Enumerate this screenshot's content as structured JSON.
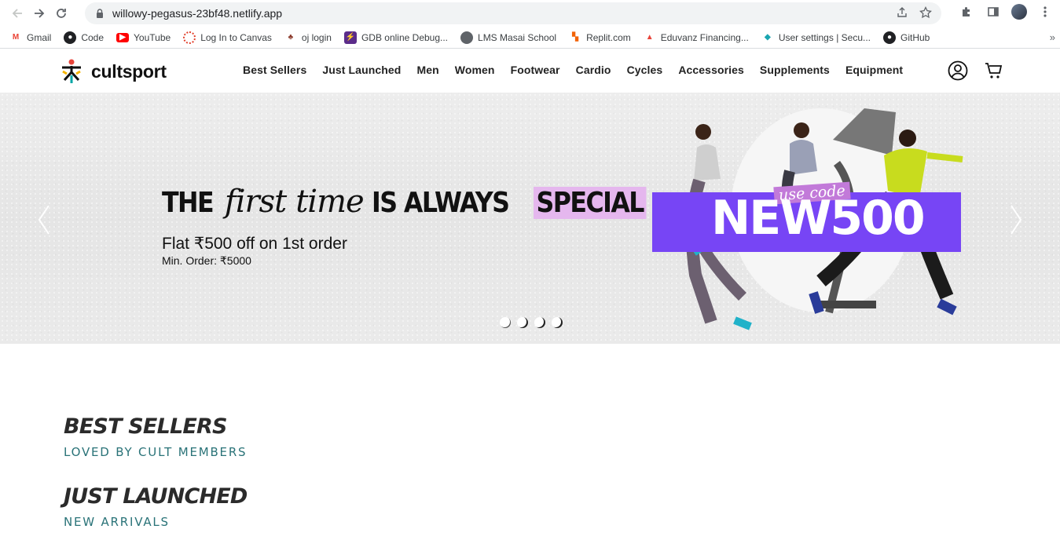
{
  "browser": {
    "url": "willowy-pegasus-23bf48.netlify.app",
    "bookmarks": [
      {
        "label": "Gmail",
        "icon": "gmail-icon",
        "color": "#ea4335"
      },
      {
        "label": "Code",
        "icon": "github-icon",
        "color": "#202124"
      },
      {
        "label": "YouTube",
        "icon": "youtube-icon",
        "color": "#ff0000"
      },
      {
        "label": "Log In to Canvas",
        "icon": "canvas-icon",
        "color": "#e13f2b"
      },
      {
        "label": "oj login",
        "icon": "oj-icon",
        "color": "#8b3a2b"
      },
      {
        "label": "GDB online Debug...",
        "icon": "gdb-icon",
        "color": "#5b2c8a"
      },
      {
        "label": "LMS Masai School",
        "icon": "globe-icon",
        "color": "#5f6368"
      },
      {
        "label": "Replit.com",
        "icon": "replit-icon",
        "color": "#f26207"
      },
      {
        "label": "Eduvanz Financing...",
        "icon": "eduvanz-icon",
        "color": "#e8443a"
      },
      {
        "label": "User settings | Secu...",
        "icon": "diamond-icon",
        "color": "#1aa5b0"
      },
      {
        "label": "GitHub",
        "icon": "github-icon",
        "color": "#202124"
      }
    ],
    "more_label": "»"
  },
  "site": {
    "brand": "cultsport",
    "nav": [
      "Best Sellers",
      "Just Launched",
      "Men",
      "Women",
      "Footwear",
      "Cardio",
      "Cycles",
      "Accessories",
      "Supplements",
      "Equipment"
    ]
  },
  "hero": {
    "headline_1": "THE",
    "headline_2": "first",
    "headline_3": "time",
    "headline_4": "IS ALWAYS",
    "headline_5": "SPECIAL",
    "offer": "Flat ₹500 off on 1st order",
    "min_order": "Min. Order: ₹5000",
    "use_code": "use code",
    "promo_code": "NEW500",
    "slide_count": 4,
    "active_slide": 1,
    "accent_color": "#7745f5",
    "highlight_color": "#e5b7ee"
  },
  "sections": [
    {
      "title": "BEST SELLERS",
      "subtitle": "LOVED BY CULT MEMBERS"
    },
    {
      "title": "JUST LAUNCHED",
      "subtitle": "NEW ARRIVALS"
    }
  ]
}
